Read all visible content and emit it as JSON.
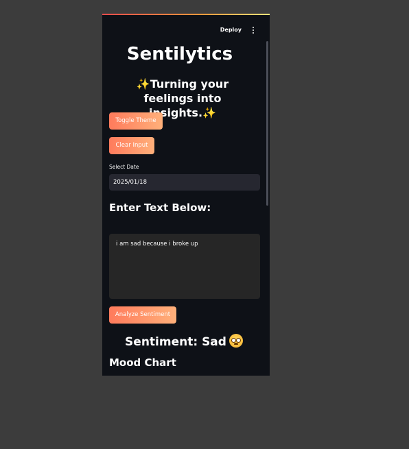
{
  "header": {
    "deploy_label": "Deploy",
    "menu_icon": "kebab-menu-icon"
  },
  "main": {
    "title": "Sentilytics",
    "subtitle_line1": "✨Turning your feelings into",
    "subtitle_line2": "insights.✨",
    "toggle_theme_label": "Toggle Theme",
    "clear_input_label": "Clear Input",
    "date_label": "Select Date",
    "date_value": "2025/01/18",
    "text_heading": "Enter Text Below:",
    "text_value": "i am sad because i broke up",
    "analyze_label": "Analyze Sentiment",
    "sentiment_result": "Sentiment: Sad",
    "sentiment_emoji": "flushed-face-icon",
    "mood_chart_heading": "Mood Chart"
  },
  "colors": {
    "page_bg": "#3c3c3c",
    "app_bg": "#0e1117",
    "button_gradient_start": "#ff7b5c",
    "button_gradient_end": "#ffb07a",
    "input_bg": "#262730"
  }
}
